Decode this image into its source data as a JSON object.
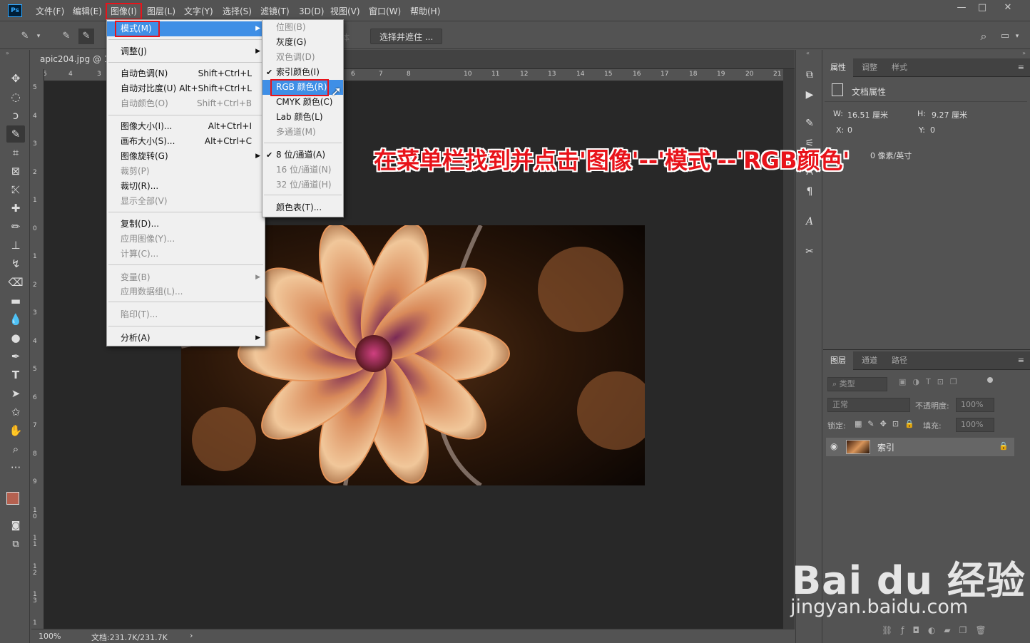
{
  "app": {
    "logo": "Ps"
  },
  "menubar": [
    "文件(F)",
    "编辑(E)",
    "图像(I)",
    "图层(L)",
    "文字(Y)",
    "选择(S)",
    "滤镜(T)",
    "3D(D)",
    "视图(V)",
    "窗口(W)",
    "帮助(H)"
  ],
  "window_controls": {
    "minimize": "—",
    "restore": "□",
    "close": "✕"
  },
  "options": {
    "partial_label": "体",
    "select_mask": "选择并遮住 ..."
  },
  "document": {
    "tab_title": "apic204.jpg @ 10",
    "zoom": "100%",
    "doc_info": "文档:231.7K/231.7K"
  },
  "ruler": {
    "h_ticks": [
      "5",
      "4",
      "3",
      "6",
      "7",
      "8",
      "10",
      "11",
      "12",
      "13",
      "14",
      "15",
      "16",
      "17",
      "18",
      "19",
      "20",
      "21"
    ],
    "v_ticks": [
      "5",
      "4",
      "3",
      "2",
      "1",
      "0",
      "1",
      "2",
      "3",
      "4",
      "5",
      "6",
      "7",
      "8",
      "9",
      "1 0",
      "1 1",
      "1 2",
      "1 3",
      "1"
    ]
  },
  "image_menu": {
    "items": [
      {
        "label": "模式(M)",
        "shortcut": "",
        "arrow": true,
        "disabled": false,
        "highlight": true
      },
      {
        "label": "调整(J)",
        "shortcut": "",
        "arrow": true,
        "disabled": false
      },
      {
        "label": "自动色调(N)",
        "shortcut": "Shift+Ctrl+L",
        "disabled": false
      },
      {
        "label": "自动对比度(U)",
        "shortcut": "Alt+Shift+Ctrl+L",
        "disabled": false
      },
      {
        "label": "自动颜色(O)",
        "shortcut": "Shift+Ctrl+B",
        "disabled": true
      },
      {
        "label": "图像大小(I)...",
        "shortcut": "Alt+Ctrl+I",
        "disabled": false
      },
      {
        "label": "画布大小(S)...",
        "shortcut": "Alt+Ctrl+C",
        "disabled": false
      },
      {
        "label": "图像旋转(G)",
        "shortcut": "",
        "arrow": true,
        "disabled": false
      },
      {
        "label": "裁剪(P)",
        "shortcut": "",
        "disabled": true
      },
      {
        "label": "裁切(R)...",
        "shortcut": "",
        "disabled": false
      },
      {
        "label": "显示全部(V)",
        "shortcut": "",
        "disabled": true
      },
      {
        "label": "复制(D)...",
        "shortcut": "",
        "disabled": false
      },
      {
        "label": "应用图像(Y)...",
        "shortcut": "",
        "disabled": true
      },
      {
        "label": "计算(C)...",
        "shortcut": "",
        "disabled": true
      },
      {
        "label": "变量(B)",
        "shortcut": "",
        "arrow": true,
        "disabled": true
      },
      {
        "label": "应用数据组(L)...",
        "shortcut": "",
        "disabled": true
      },
      {
        "label": "陷印(T)...",
        "shortcut": "",
        "disabled": true
      },
      {
        "label": "分析(A)",
        "shortcut": "",
        "arrow": true,
        "disabled": false
      }
    ]
  },
  "mode_submenu": {
    "items": [
      {
        "label": "位图(B)",
        "disabled": true
      },
      {
        "label": "灰度(G)",
        "disabled": false
      },
      {
        "label": "双色调(D)",
        "disabled": true
      },
      {
        "label": "索引颜色(I)",
        "disabled": false,
        "checked": true
      },
      {
        "label": "RGB 颜色(R)",
        "disabled": false,
        "highlight": true
      },
      {
        "label": "CMYK 颜色(C)",
        "disabled": false
      },
      {
        "label": "Lab 颜色(L)",
        "disabled": false
      },
      {
        "label": "多通道(M)",
        "disabled": true
      },
      {
        "label": "8 位/通道(A)",
        "disabled": false,
        "checked": true
      },
      {
        "label": "16 位/通道(N)",
        "disabled": true
      },
      {
        "label": "32 位/通道(H)",
        "disabled": true
      },
      {
        "label": "颜色表(T)...",
        "disabled": false
      }
    ]
  },
  "annotation": "在菜单栏找到并点击'图像'--'模式'--'RGB颜色'",
  "properties_panel": {
    "tabs": [
      "属性",
      "调整",
      "样式"
    ],
    "header": "文档属性",
    "w_label": "W:",
    "w_value": "16.51 厘米",
    "h_label": "H:",
    "h_value": "9.27 厘米",
    "x_label": "X:",
    "x_value": "0",
    "y_label": "Y:",
    "y_value": "0",
    "resolution_unit": "0 像素/英寸"
  },
  "layers_panel": {
    "tabs": [
      "图层",
      "通道",
      "路径"
    ],
    "filter_placeholder": "类型",
    "blend_mode": "正常",
    "opacity_label": "不透明度:",
    "opacity_value": "100%",
    "lock_label": "锁定:",
    "fill_label": "填充:",
    "fill_value": "100%",
    "layer_name": "索引",
    "bottom_icons": [
      "link-icon",
      "fx-icon",
      "mask-icon",
      "adjustment-icon",
      "folder-icon",
      "new-layer-icon",
      "trash-icon"
    ]
  },
  "watermark": {
    "brand": "Bai du 经验",
    "url": "jingyan.baidu.com"
  },
  "colors": {
    "accent_red": "#e8131a",
    "highlight_blue": "#3f8fe6",
    "ps_blue": "#31a8ff"
  }
}
